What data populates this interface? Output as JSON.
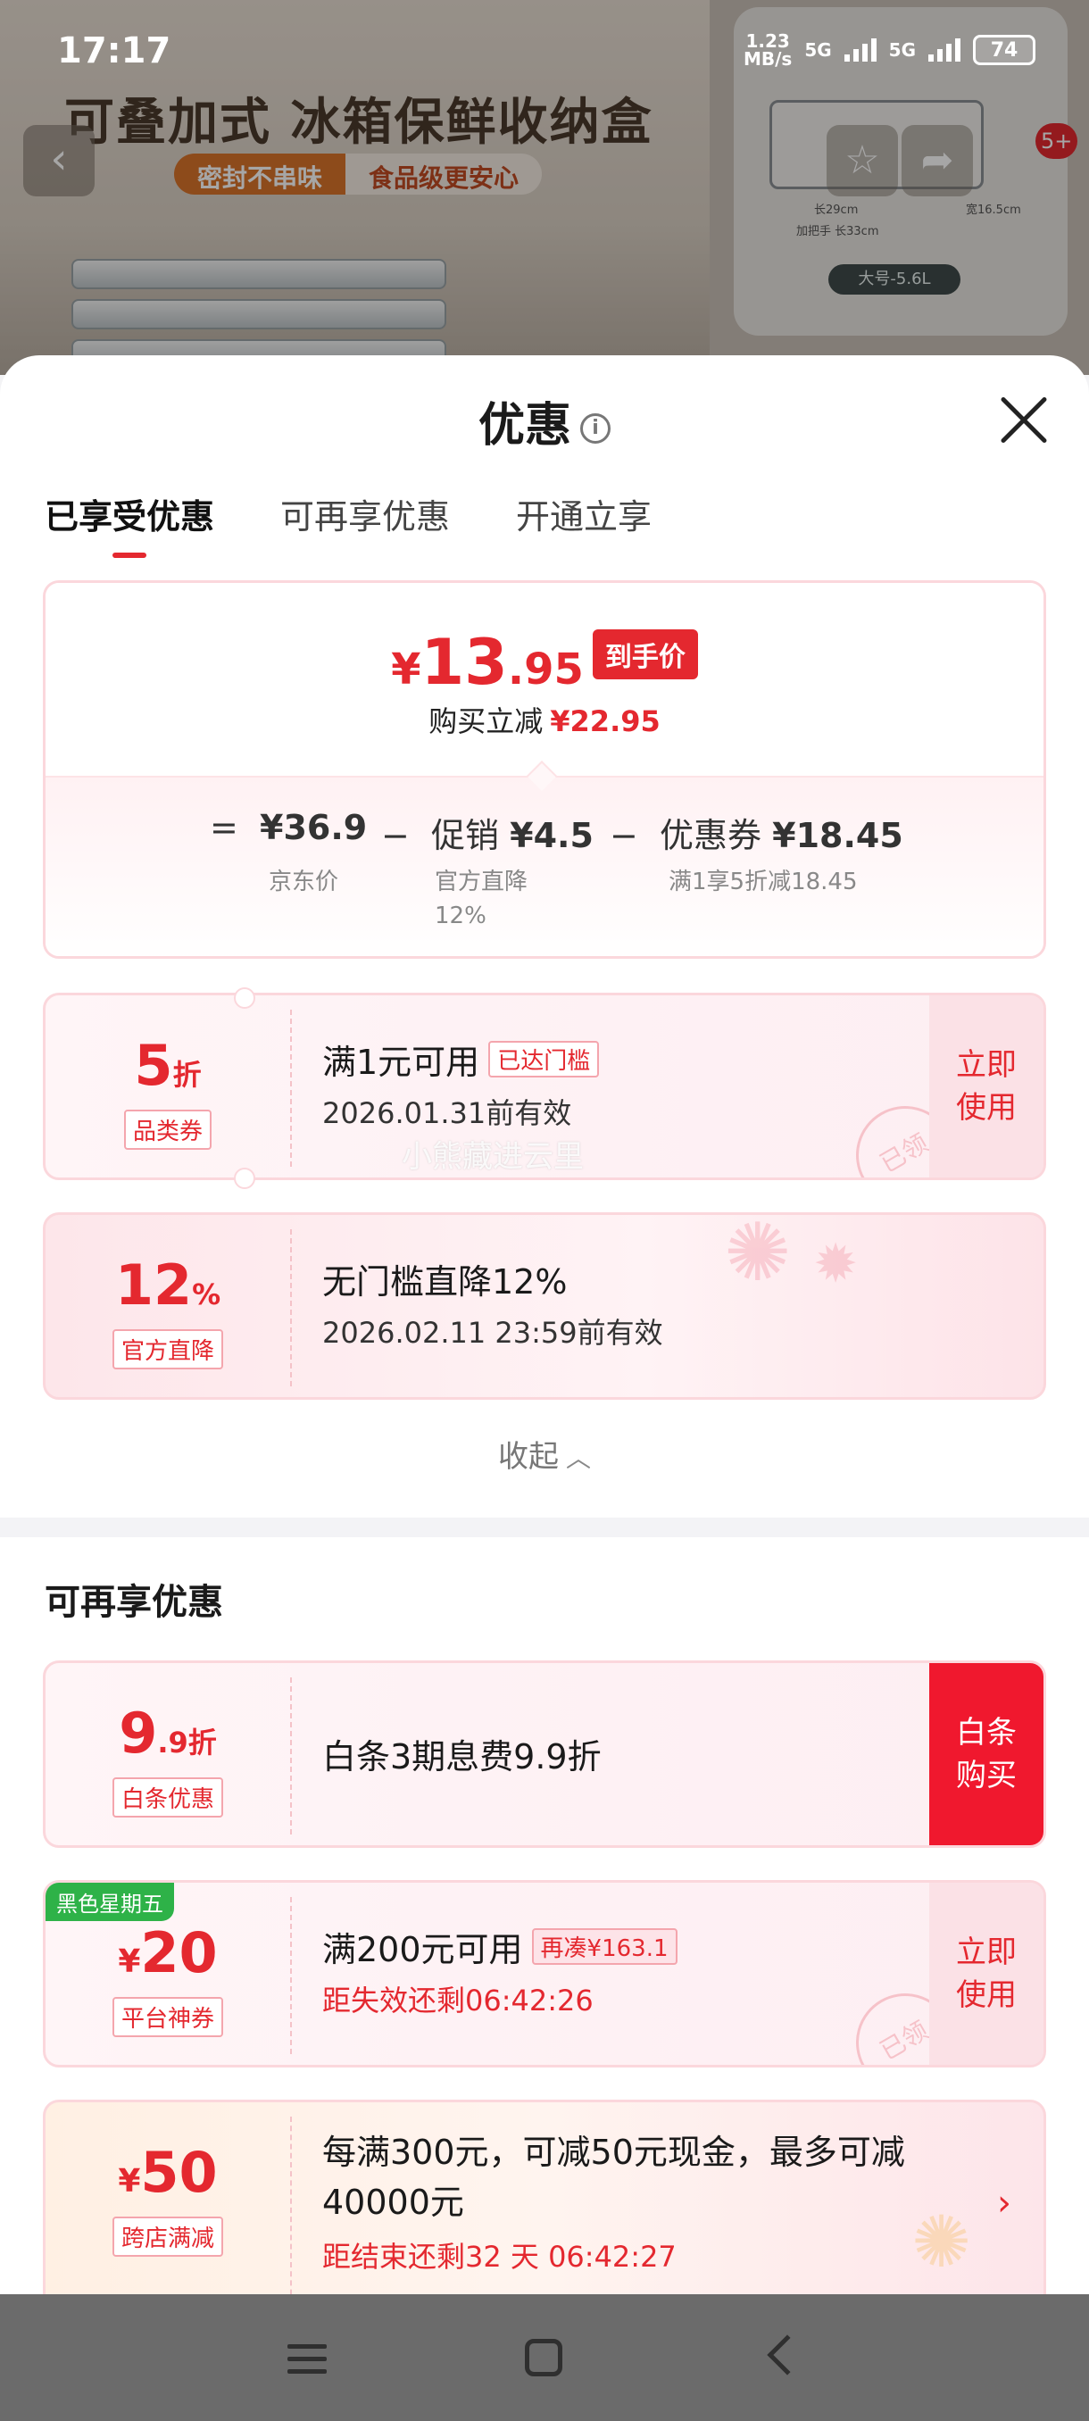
{
  "status_bar": {
    "time": "17:17",
    "net_speed_value": "1.23",
    "net_speed_unit": "MB/s",
    "net1": "5G",
    "net2": "5G",
    "battery": "74"
  },
  "background": {
    "banner_title": "可叠加式 冰箱保鲜收纳盒",
    "tag1": "密封不串味",
    "tag2": "食品级更安心",
    "size_label": "大号-5.6L",
    "dim_length": "长29cm",
    "dim_width": "宽16.5cm",
    "dim_handle": "加把手 长33cm",
    "badge": "5+"
  },
  "sheet": {
    "title": "优惠",
    "info_icon": "i",
    "tabs": [
      {
        "label": "已享受优惠",
        "active": true
      },
      {
        "label": "可再享优惠",
        "active": false
      },
      {
        "label": "开通立享",
        "active": false
      }
    ]
  },
  "summary": {
    "currency": "¥",
    "final_int": "13",
    "final_dec": ".95",
    "final_tag": "到手价",
    "save_label": "购买立减",
    "save_amount": "¥22.95",
    "breakdown": [
      {
        "op": "=",
        "label": "",
        "value": "¥36.9",
        "sub": "京东价"
      },
      {
        "op": "−",
        "label": "促销",
        "value": "¥4.5",
        "sub": "官方直降",
        "sub2": "12%"
      },
      {
        "op": "−",
        "label": "优惠券",
        "value": "¥18.45",
        "sub": "满1享5折减18.45"
      }
    ]
  },
  "enjoyed_coupons": [
    {
      "value": "5",
      "unit": "折",
      "label": "品类券",
      "title": "满1元可用",
      "pill": "已达门槛",
      "subtitle": "2026.01.31前有效",
      "action": "立即使用",
      "stamp": "已领"
    },
    {
      "value": "12",
      "unit": "%",
      "label": "官方直降",
      "title": "无门槛直降12%",
      "subtitle": "2026.02.11 23:59前有效"
    }
  ],
  "collapse_label": "收起",
  "watermark": "小熊藏进云里",
  "more_section": {
    "title": "可再享优惠",
    "coupons": [
      {
        "value_int": "9",
        "value_dec": ".9",
        "unit": "折",
        "label": "白条优惠",
        "title": "白条3期息费9.9折",
        "action": "白条购买"
      },
      {
        "corner_tag": "黑色星期五",
        "currency": "¥",
        "value": "20",
        "label": "平台神券",
        "title": "满200元可用",
        "pill": "再凑¥163.1",
        "subtitle": "距失效还剩06:42:26",
        "action": "立即使用",
        "stamp": "已领"
      },
      {
        "currency": "¥",
        "value": "50",
        "label": "跨店满减",
        "title": "每满300元，可减50元现金，最多可减40000元",
        "subtitle": "距结束还剩32 天 06:42:27"
      }
    ]
  },
  "colors": {
    "accent": "#e4282f",
    "corner_tag": "#2eb248"
  }
}
